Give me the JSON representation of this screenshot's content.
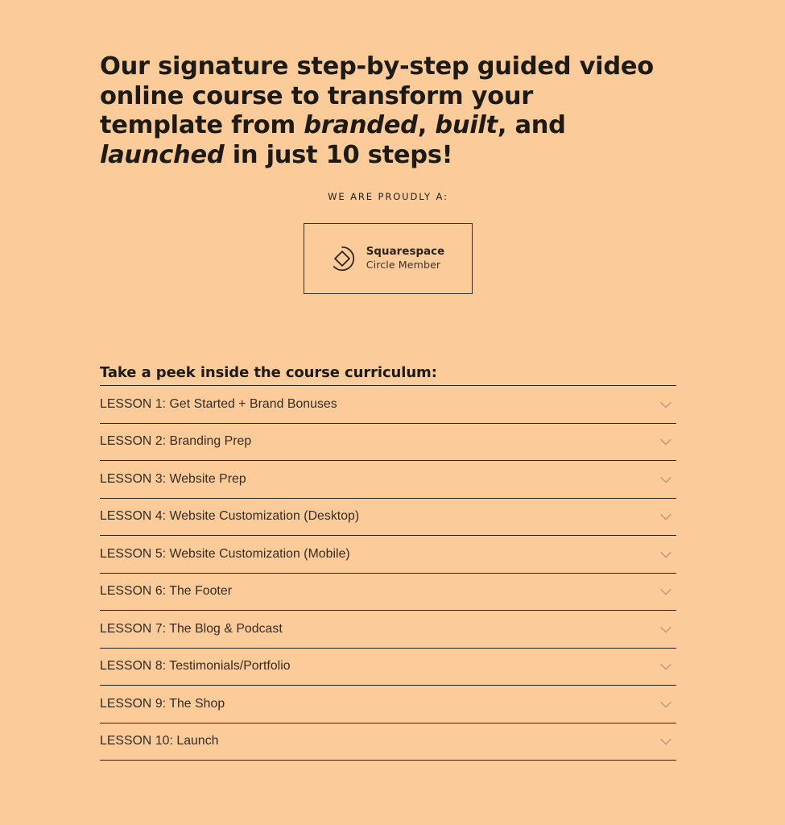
{
  "theme": {
    "background": "#fccb9a",
    "text_dark": "#1c1b17",
    "rule": "#2e2317",
    "chevron": "#b89a79"
  },
  "headline": {
    "part1": "Our signature step-by-step guided video online course to transform your template from ",
    "em1": "branded",
    "sep1": ", ",
    "em2": "built",
    "sep2": ", and ",
    "em3": "launched",
    "part2": " in just 10 steps!",
    "full_text": "Our signature step-by-step guided video online course to transform your template from branded, built, and launched in just 10 steps!"
  },
  "badge_section": {
    "label": "WE ARE PROUDLY A:",
    "badge": {
      "icon": "squarespace-circle-icon",
      "title": "Squarespace",
      "subtitle": "Circle Member"
    }
  },
  "curriculum": {
    "heading": "Take a peek inside the course curriculum:",
    "toggle_icon": "chevron-down-icon",
    "lessons": [
      {
        "label": "LESSON 1: Get Started + Brand Bonuses"
      },
      {
        "label": "LESSON 2: Branding Prep"
      },
      {
        "label": "LESSON 3: Website Prep"
      },
      {
        "label": "LESSON 4: Website Customization (Desktop)"
      },
      {
        "label": "LESSON 5: Website Customization (Mobile)"
      },
      {
        "label": "LESSON 6: The Footer"
      },
      {
        "label": "LESSON 7: The Blog & Podcast"
      },
      {
        "label": "LESSON 8: Testimonials/Portfolio"
      },
      {
        "label": "LESSON 9: The Shop"
      },
      {
        "label": "LESSON 10: Launch"
      }
    ]
  }
}
